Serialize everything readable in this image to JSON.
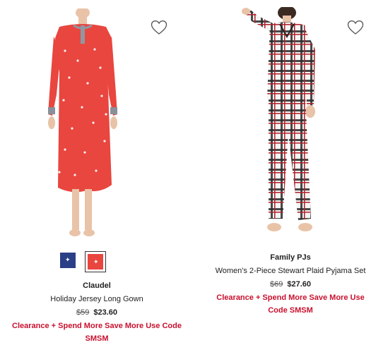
{
  "products": [
    {
      "brand": "Claudel",
      "name": "Holiday Jersey Long Gown",
      "was_price": "$59",
      "price": "$23.60",
      "promo": "Clearance + Spend More Save More Use Code SMSM",
      "swatches": [
        {
          "color": "#2b3f86",
          "selected": false
        },
        {
          "color": "#e8463f",
          "selected": true
        }
      ]
    },
    {
      "brand": "Family PJs",
      "name": "Women's 2-Piece Stewart Plaid Pyjama Set",
      "was_price": "$69",
      "price": "$27.60",
      "promo": "Clearance + Spend More Save More Use Code SMSM"
    }
  ],
  "colors": {
    "promo_red": "#c8102e",
    "gown_red": "#e8463f",
    "navy": "#2b3f86"
  },
  "icons": {
    "favorite": "heart-outline-icon"
  }
}
